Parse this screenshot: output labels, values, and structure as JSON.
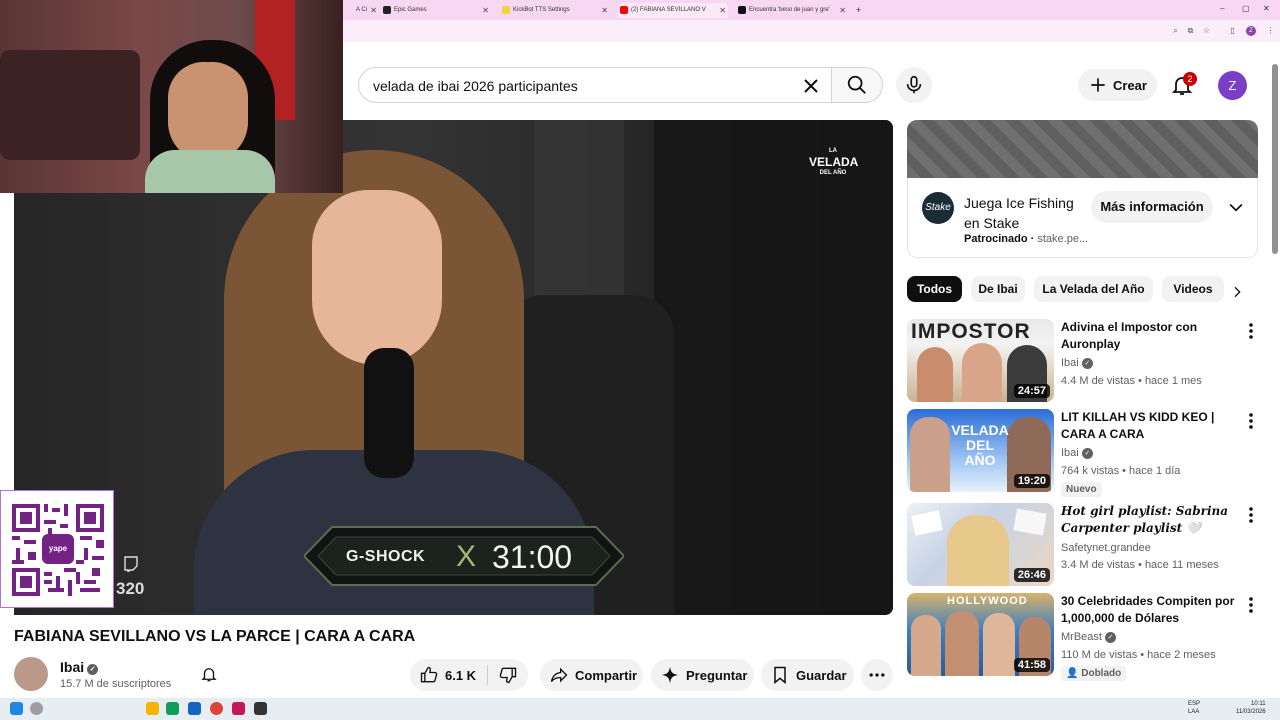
{
  "browser": {
    "tabs": [
      {
        "label": "A Ci",
        "active": false
      },
      {
        "label": "Epic Games",
        "active": false
      },
      {
        "label": "KickBot TTS Settings",
        "active": false
      },
      {
        "label": "(2) FABIANA SEVILLANO V",
        "active": true
      },
      {
        "label": "Encuentra 'beso de juan y gre'",
        "active": false
      }
    ],
    "new_tab": "+",
    "profile_initial": "Z"
  },
  "header": {
    "search_value": "velada de ibai 2026 participantes",
    "create_label": "Crear",
    "notification_count": "2",
    "avatar_initial": "Z"
  },
  "player": {
    "logo_text_line1": "LA",
    "logo_text_line2": "VELADA",
    "logo_text_line3": "DEL AÑO",
    "sponsor_brand": "G-SHOCK",
    "sponsor_separator": "X",
    "timer": "31:00",
    "side_number": "320"
  },
  "qr": {
    "badge": "yape"
  },
  "video": {
    "title": "FABIANA SEVILLANO VS LA PARCE | CARA A CARA",
    "channel": "Ibai",
    "subscribers": "15.7 M de suscriptores",
    "likes": "6.1 K",
    "share_label": "Compartir",
    "ask_label": "Preguntar",
    "save_label": "Guardar"
  },
  "ad": {
    "logo": "Stake",
    "title": "Juega Ice Fishing en Stake",
    "sponsored": "Patrocinado",
    "domain": "stake.pe...",
    "cta": "Más información"
  },
  "chips": [
    "Todos",
    "De Ibai",
    "La Velada del Año",
    "Videos"
  ],
  "recommendations": [
    {
      "title": "Adivina el Impostor con Auronplay",
      "channel": "Ibai",
      "meta": "4.4 M de vistas • hace 1 mes",
      "duration": "24:57",
      "badge": "",
      "thumb_text": "IMPOSTOR"
    },
    {
      "title": "LIT KILLAH VS KIDD KEO | CARA A CARA",
      "channel": "Ibai",
      "meta": "764 k vistas • hace 1 día",
      "duration": "19:20",
      "badge": "Nuevo",
      "thumb_text": "VELADA DEL AÑO"
    },
    {
      "title": "Hot girl playlist: Sabrina Carpenter playlist 🤍",
      "channel": "Safetynet.grandee",
      "meta": "3.4 M de vistas • hace 11 meses",
      "duration": "26:46",
      "badge": "",
      "thumb_text": ""
    },
    {
      "title": "30 Celebridades Compiten por 1,000,000 de Dólares",
      "channel": "MrBeast",
      "meta": "110 M de vistas • hace 2 meses",
      "duration": "41:58",
      "badge": "Doblado",
      "thumb_text": "HOLLYWOOD"
    }
  ],
  "taskbar": {
    "lang_line1": "ESP",
    "lang_line2": "LAA",
    "time": "10:11",
    "date": "11/03/2026"
  }
}
